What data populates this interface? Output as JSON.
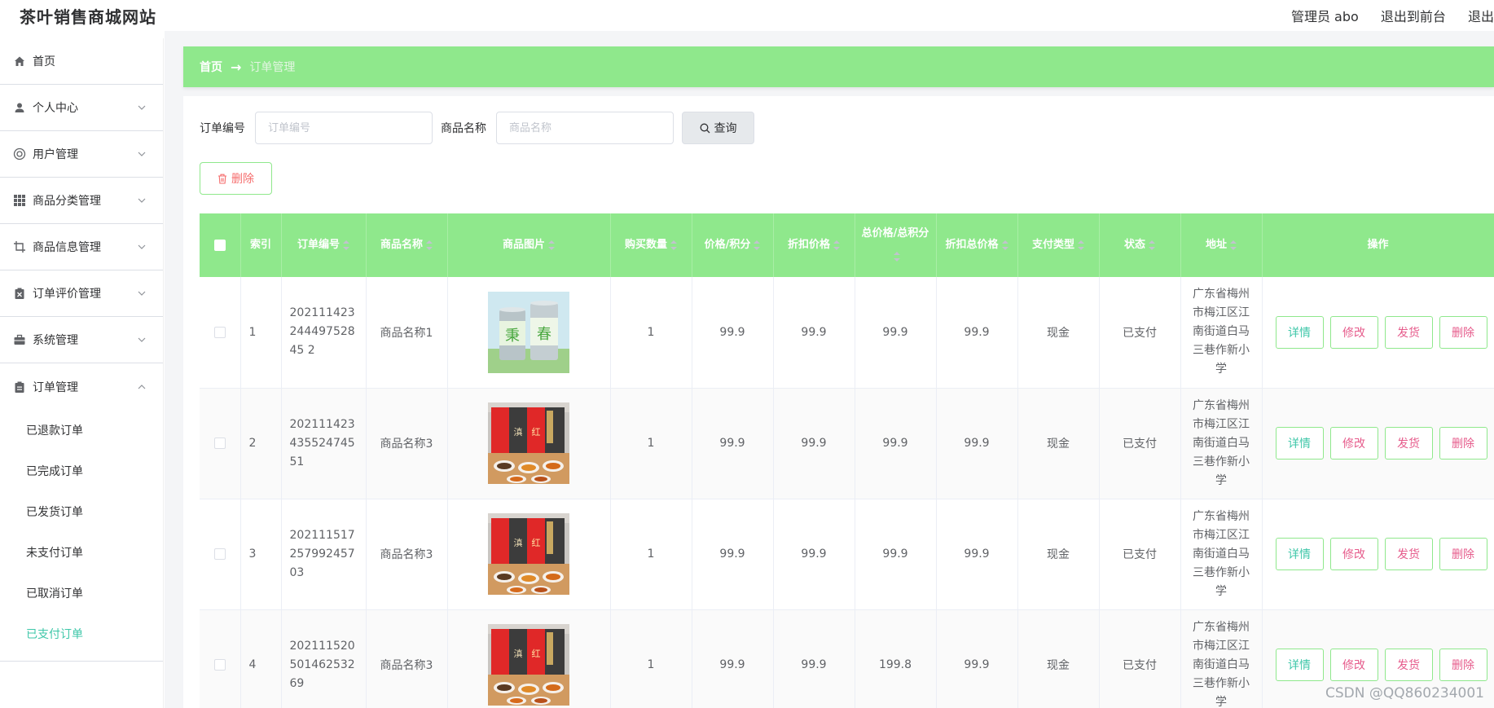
{
  "header": {
    "site_title": "茶叶销售商城网站",
    "admin_label": "管理员 abo",
    "exit_front": "退出到前台",
    "logout": "退出"
  },
  "sidebar": {
    "items": [
      {
        "label": "首页",
        "icon": "home-icon"
      },
      {
        "label": "个人中心",
        "icon": "user-icon"
      },
      {
        "label": "用户管理",
        "icon": "users-icon"
      },
      {
        "label": "商品分类管理",
        "icon": "grid-icon"
      },
      {
        "label": "商品信息管理",
        "icon": "crop-icon"
      },
      {
        "label": "订单评价管理",
        "icon": "clipboard-icon"
      },
      {
        "label": "系统管理",
        "icon": "briefcase-icon"
      },
      {
        "label": "订单管理",
        "icon": "order-icon"
      }
    ],
    "submenu": [
      {
        "label": "已退款订单"
      },
      {
        "label": "已完成订单"
      },
      {
        "label": "已发货订单"
      },
      {
        "label": "未支付订单"
      },
      {
        "label": "已取消订单"
      },
      {
        "label": "已支付订单",
        "active": true
      }
    ]
  },
  "breadcrumb": {
    "home": "首页",
    "arrow": "→",
    "current": "订单管理"
  },
  "search": {
    "order_no_label": "订单编号",
    "order_no_placeholder": "订单编号",
    "goods_name_label": "商品名称",
    "goods_name_placeholder": "商品名称",
    "query_button": "查询"
  },
  "actions": {
    "delete_button": "删除"
  },
  "table": {
    "columns": [
      "索引",
      "订单编号",
      "商品名称",
      "商品图片",
      "购买数量",
      "价格/积分",
      "折扣价格",
      "总价格/总积分",
      "折扣总价格",
      "支付类型",
      "状态",
      "地址",
      "操作"
    ],
    "rows": [
      {
        "index": "1",
        "order_no": "20211142324449752845 2",
        "goods_name": "商品名称1",
        "image": "green-tea-cans",
        "qty": "1",
        "price": "99.9",
        "discount_price": "99.9",
        "total_price": "99.9",
        "discount_total": "99.9",
        "pay_type": "现金",
        "status": "已支付",
        "address": "广东省梅州市梅江区江南街道白马三巷作新小学"
      },
      {
        "index": "2",
        "order_no": "20211142343552474551",
        "goods_name": "商品名称3",
        "image": "red-tea-cans",
        "qty": "1",
        "price": "99.9",
        "discount_price": "99.9",
        "total_price": "99.9",
        "discount_total": "99.9",
        "pay_type": "现金",
        "status": "已支付",
        "address": "广东省梅州市梅江区江南街道白马三巷作新小学"
      },
      {
        "index": "3",
        "order_no": "20211151725799245703",
        "goods_name": "商品名称3",
        "image": "red-tea-cans",
        "qty": "1",
        "price": "99.9",
        "discount_price": "99.9",
        "total_price": "99.9",
        "discount_total": "99.9",
        "pay_type": "现金",
        "status": "已支付",
        "address": "广东省梅州市梅江区江南街道白马三巷作新小学"
      },
      {
        "index": "4",
        "order_no": "20211152050146253269",
        "goods_name": "商品名称3",
        "image": "red-tea-cans",
        "qty": "1",
        "price": "99.9",
        "discount_price": "99.9",
        "total_price": "199.8",
        "discount_total": "99.9",
        "pay_type": "现金",
        "status": "已支付",
        "address": "广东省梅州市梅江区江南街道白马三巷作新小学"
      }
    ],
    "row_actions": {
      "detail": "详情",
      "edit": "修改",
      "ship": "发货",
      "delete": "删除"
    }
  },
  "watermark": "CSDN @QQ860234001",
  "colors": {
    "accent_green": "#8fe88c",
    "active_text": "#3fc7a9",
    "danger_text": "#e65c8c"
  }
}
